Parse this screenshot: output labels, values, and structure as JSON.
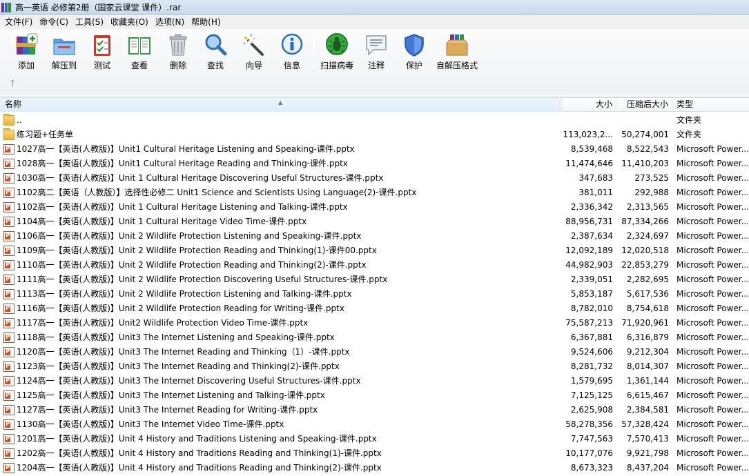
{
  "window": {
    "title": "高一英语 必修第2册（国家云课堂 课件）.rar"
  },
  "menu": [
    "文件(F)",
    "命令(C)",
    "工具(S)",
    "收藏夹(O)",
    "选项(N)",
    "帮助(H)"
  ],
  "toolbar": [
    {
      "label": "添加",
      "icon": "add-books-icon"
    },
    {
      "label": "解压到",
      "icon": "extract-folder-icon"
    },
    {
      "label": "测试",
      "icon": "test-clipboard-icon"
    },
    {
      "label": "查看",
      "icon": "view-book-icon"
    },
    {
      "label": "删除",
      "icon": "trash-icon"
    },
    {
      "label": "查找",
      "icon": "magnifier-icon"
    },
    {
      "label": "向导",
      "icon": "wand-icon"
    },
    {
      "label": "信息",
      "icon": "info-icon"
    },
    {
      "label": "扫描病毒",
      "icon": "bug-scan-icon"
    },
    {
      "label": "注释",
      "icon": "comment-icon"
    },
    {
      "label": "保护",
      "icon": "shield-icon"
    },
    {
      "label": "自解压格式",
      "icon": "sfx-package-icon"
    }
  ],
  "columns": {
    "name": "名称",
    "size": "大小",
    "packed": "压缩后大小",
    "type": "类型"
  },
  "files": [
    {
      "icon": "folder",
      "name": "..",
      "size": "",
      "packed": "",
      "type": "文件夹"
    },
    {
      "icon": "folder",
      "name": "练习题+任务单",
      "size": "113,023,2...",
      "packed": "50,274,001",
      "type": "文件夹"
    },
    {
      "icon": "ppt",
      "name": "1027高一【英语(人教版)】Unit1 Cultural Heritage  Listening and Speaking-课件.pptx",
      "size": "8,539,468",
      "packed": "8,522,543",
      "type": "Microsoft Power..."
    },
    {
      "icon": "ppt",
      "name": "1028高一【英语(人教版)】Unit1 Cultural Heritage  Reading and Thinking-课件.pptx",
      "size": "11,474,646",
      "packed": "11,410,203",
      "type": "Microsoft Power..."
    },
    {
      "icon": "ppt",
      "name": "1030高一【英语(人教版)】Unit 1 Cultural Heritage Discovering Useful Structures-课件.pptx",
      "size": "347,683",
      "packed": "273,525",
      "type": "Microsoft Power..."
    },
    {
      "icon": "ppt",
      "name": "1102高二【英语（人教版）】选择性必修二 Unit1 Science and Scientists  Using Language(2)-课件.pptx",
      "size": "381,011",
      "packed": "292,988",
      "type": "Microsoft Power..."
    },
    {
      "icon": "ppt",
      "name": "1102高一【英语(人教版)】Unit 1 Cultural Heritage  Listening and Talking-课件.pptx",
      "size": "2,336,342",
      "packed": "2,313,565",
      "type": "Microsoft Power..."
    },
    {
      "icon": "ppt",
      "name": "1104高一【英语(人教版)】Unit 1 Cultural Heritage Video Time-课件.pptx",
      "size": "88,956,731",
      "packed": "87,334,266",
      "type": "Microsoft Power..."
    },
    {
      "icon": "ppt",
      "name": "1106高一【英语(人教版)】Unit 2 Wildlife Protection  Listening and Speaking-课件.pptx",
      "size": "2,387,634",
      "packed": "2,324,697",
      "type": "Microsoft Power..."
    },
    {
      "icon": "ppt",
      "name": "1109高一【英语(人教版)】Unit 2 Wildlife Protection  Reading and Thinking(1)-课件00.pptx",
      "size": "12,092,189",
      "packed": "12,020,518",
      "type": "Microsoft Power..."
    },
    {
      "icon": "ppt",
      "name": "1110高一【英语(人教版)】Unit 2 Wildlife Protection Reading and Thinking(2)-课件.pptx",
      "size": "44,982,903",
      "packed": "22,853,279",
      "type": "Microsoft Power..."
    },
    {
      "icon": "ppt",
      "name": "1111高一【英语(人教版)】Unit 2 Wildlife Protection Discovering Useful Structures-课件.pptx",
      "size": "2,339,051",
      "packed": "2,282,695",
      "type": "Microsoft Power..."
    },
    {
      "icon": "ppt",
      "name": "1113高一【英语(人教版)】Unit 2 Wildlife Protection Listening and Talking-课件.pptx",
      "size": "5,853,187",
      "packed": "5,617,536",
      "type": "Microsoft Power..."
    },
    {
      "icon": "ppt",
      "name": "1116高一【英语(人教版)】Unit 2 Wildlife Protection Reading for Writing-课件.pptx",
      "size": "8,782,010",
      "packed": "8,754,618",
      "type": "Microsoft Power..."
    },
    {
      "icon": "ppt",
      "name": "1117高一【英语(人教版)】Unit2 Wildlife Protection Video Time-课件.pptx",
      "size": "75,587,213",
      "packed": "71,920,961",
      "type": "Microsoft Power..."
    },
    {
      "icon": "ppt",
      "name": "1118高一【英语(人教版)】Unit3 The Internet Listening and Speaking-课件.pptx",
      "size": "6,367,881",
      "packed": "6,316,879",
      "type": "Microsoft Power..."
    },
    {
      "icon": "ppt",
      "name": "1120高一【英语(人教版)】Unit3 The Internet Reading and Thinking（1）-课件.pptx",
      "size": "9,524,606",
      "packed": "9,212,304",
      "type": "Microsoft Power..."
    },
    {
      "icon": "ppt",
      "name": "1123高一【英语(人教版)】Unit3 The Internet Reading and Thinking(2)-课件.pptx",
      "size": "8,281,732",
      "packed": "8,014,307",
      "type": "Microsoft Power..."
    },
    {
      "icon": "ppt",
      "name": "1124高一【英语(人教版)】Unit3 The Internet  Discovering Useful Structures-课件.pptx",
      "size": "1,579,695",
      "packed": "1,361,144",
      "type": "Microsoft Power..."
    },
    {
      "icon": "ppt",
      "name": "1125高一【英语(人教版)】Unit3 The Internet Listening and Talking-课件.pptx",
      "size": "7,125,125",
      "packed": "6,615,467",
      "type": "Microsoft Power..."
    },
    {
      "icon": "ppt",
      "name": "1127高一【英语(人教版)】Unit3 The Internet Reading for Writing-课件.pptx",
      "size": "2,625,908",
      "packed": "2,384,581",
      "type": "Microsoft Power..."
    },
    {
      "icon": "ppt",
      "name": "1130高一【英语(人教版)】Unit3 The Internet Video Time-课件.pptx",
      "size": "58,278,356",
      "packed": "57,328,424",
      "type": "Microsoft Power..."
    },
    {
      "icon": "ppt",
      "name": "1201高一【英语(人教版)】Unit 4 History and Traditions Listening and Speaking-课件.pptx",
      "size": "7,747,563",
      "packed": "7,570,413",
      "type": "Microsoft Power..."
    },
    {
      "icon": "ppt",
      "name": "1202高一【英语(人教版)】Unit 4 History and Traditions Reading and Thinking(1)-课件.pptx",
      "size": "10,177,076",
      "packed": "9,921,798",
      "type": "Microsoft Power..."
    },
    {
      "icon": "ppt",
      "name": "1204高一【英语(人教版)】Unit 4 History and Traditions Reading and Thinking(2)-课件.pptx",
      "size": "8,673,323",
      "packed": "8,437,204",
      "type": "Microsoft Power..."
    }
  ]
}
